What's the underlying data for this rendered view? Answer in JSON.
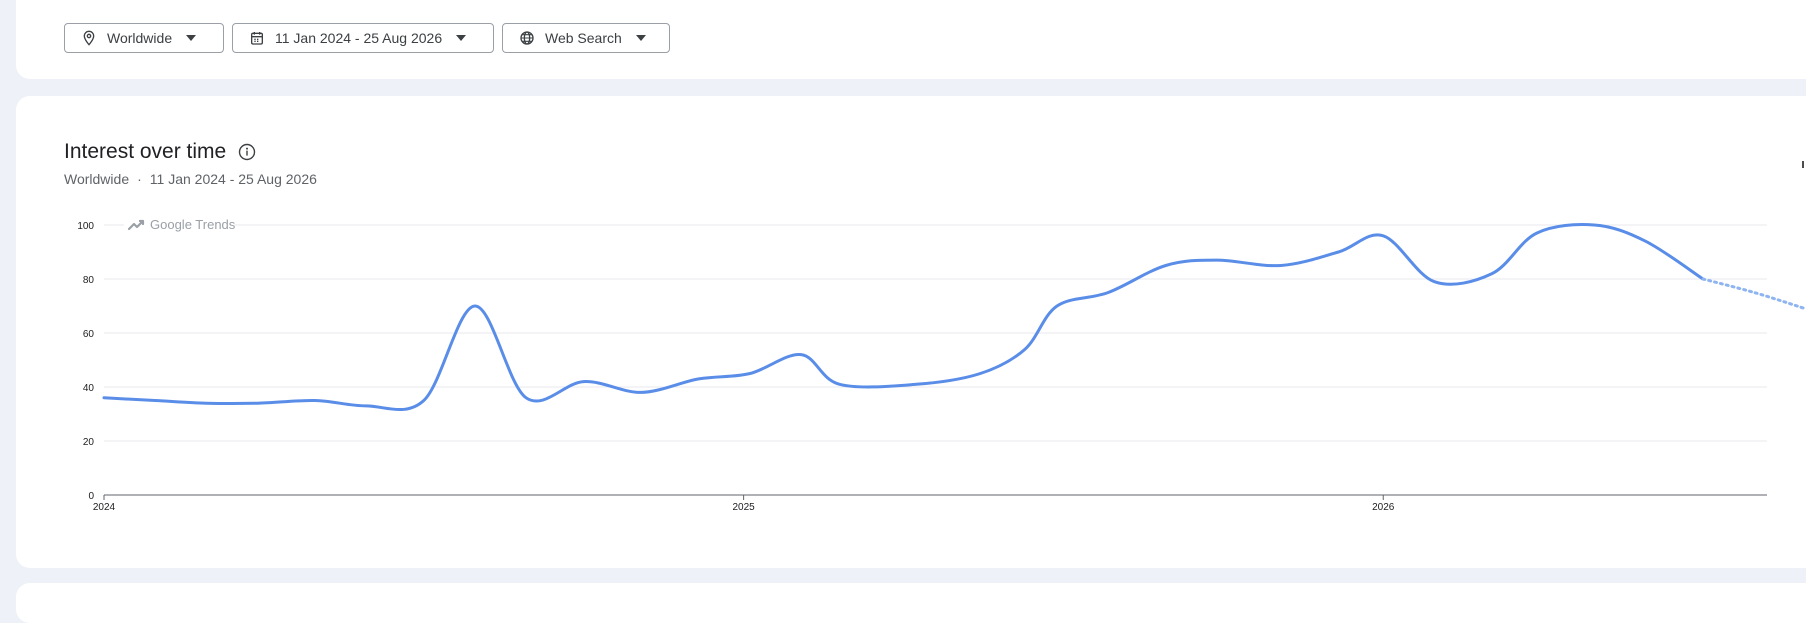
{
  "filters": {
    "location": "Worldwide",
    "date_range": "11 Jan 2024 - 25 Aug 2026",
    "search_type": "Web Search"
  },
  "icons": {
    "location": "location-pin-icon",
    "date_range": "calendar-icon",
    "search_type": "globe-icon",
    "dropdown": "caret-down-icon",
    "info": "info-icon",
    "watermark": "trend-line-icon"
  },
  "colors": {
    "line": "#5a8de8",
    "grid": "#e8eaed",
    "axis": "#202124"
  },
  "chart_header": {
    "title": "Interest over time",
    "sub_location": "Worldwide",
    "sub_separator": "·",
    "sub_range": "11 Jan 2024 - 25 Aug 2026"
  },
  "watermark": "Google Trends",
  "chart_data": {
    "type": "line",
    "title": "Interest over time",
    "xlabel": "",
    "ylabel": "",
    "ylim": [
      0,
      100
    ],
    "yticks": [
      0,
      20,
      40,
      60,
      80,
      100
    ],
    "x_range": [
      2024.0,
      2026.66
    ],
    "xticks": [
      {
        "value": 2024,
        "label": "2024"
      },
      {
        "value": 2025,
        "label": "2025"
      },
      {
        "value": 2026,
        "label": "2026"
      }
    ],
    "grid": true,
    "series": [
      {
        "x": [
          2024.0,
          2024.08,
          2024.16,
          2024.24,
          2024.33,
          2024.41,
          2024.5,
          2024.58,
          2024.66,
          2024.75,
          2024.84,
          2024.93,
          2025.01,
          2025.09,
          2025.15,
          2025.27,
          2025.37,
          2025.44,
          2025.49,
          2025.57,
          2025.66,
          2025.74,
          2025.84,
          2025.93,
          2026.0,
          2026.08,
          2026.17,
          2026.24,
          2026.33,
          2026.41,
          2026.5
        ],
        "y": [
          36,
          35,
          34,
          34,
          35,
          33,
          35,
          70,
          36,
          42,
          38,
          43,
          45,
          52,
          41,
          41,
          45,
          54,
          70,
          75,
          85,
          87,
          85,
          90,
          96,
          79,
          82,
          97,
          100,
          94,
          80
        ]
      }
    ],
    "forecast": {
      "x": [
        2026.5,
        2026.58,
        2026.66
      ],
      "y": [
        80,
        75,
        69
      ]
    }
  }
}
